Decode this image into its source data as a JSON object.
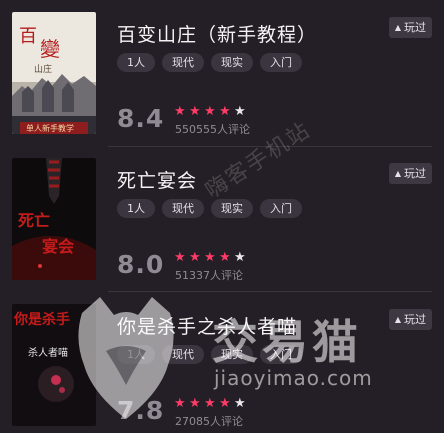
{
  "games": [
    {
      "title": "百变山庄（新手教程）",
      "tags": [
        "1人",
        "现代",
        "现实",
        "入门"
      ],
      "score": "8.4",
      "stars": 4,
      "reviews": "550555人评论",
      "want_label": "玩过",
      "cover_text": {
        "title_a": "百",
        "title_b": "變",
        "sub": "山庄",
        "banner": "单人新手教学"
      }
    },
    {
      "title": "死亡宴会",
      "tags": [
        "1人",
        "现代",
        "现实",
        "入门"
      ],
      "score": "8.0",
      "stars": 4,
      "reviews": "51337人评论",
      "want_label": "玩过",
      "cover_text": {
        "title_a": "死亡",
        "title_b": "宴会"
      }
    },
    {
      "title": "你是杀手之杀人者喵",
      "tags": [
        "1人",
        "现代",
        "现实",
        "入门"
      ],
      "score": "7.8",
      "stars": 4,
      "reviews": "27085人评论",
      "want_label": "玩过",
      "cover_text": {
        "title_a": "你是杀手",
        "title_b": "杀人者喵"
      }
    }
  ],
  "watermark": {
    "brand": "交易猫",
    "url": "jiaoyimao.com",
    "diagonal": "嗨客手机站"
  },
  "colors": {
    "background": "#241f26",
    "star_on": "#ff3b67",
    "star_off": "#e9e7ea",
    "tag_bg": "#3b3540"
  },
  "icons": {
    "want_button": "triangle-up-icon",
    "rating": "star-icon",
    "watermark": "cat-logo-icon"
  }
}
